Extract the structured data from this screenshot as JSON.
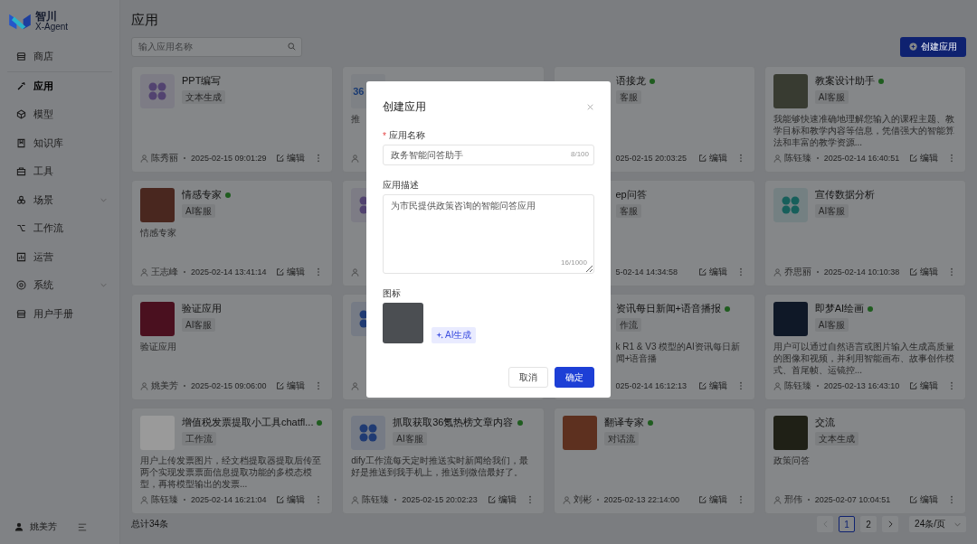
{
  "sidebar": {
    "brand": {
      "name": "智川",
      "subtitle": "X-Agent"
    },
    "items": [
      {
        "label": "商店",
        "selected": false,
        "submenu": false
      },
      {
        "label": "应用",
        "selected": true,
        "submenu": false
      },
      {
        "label": "模型",
        "selected": false,
        "submenu": false
      },
      {
        "label": "知识库",
        "selected": false,
        "submenu": false
      },
      {
        "label": "工具",
        "selected": false,
        "submenu": false
      },
      {
        "label": "场景",
        "selected": false,
        "submenu": true,
        "expanded": false
      },
      {
        "label": "工作流",
        "selected": false,
        "submenu": false
      },
      {
        "label": "运营",
        "selected": false,
        "submenu": false
      },
      {
        "label": "系统",
        "selected": false,
        "submenu": true,
        "expanded": false
      },
      {
        "label": "用户手册",
        "selected": false,
        "submenu": false
      }
    ],
    "user": {
      "name": "姚美芳"
    }
  },
  "page": {
    "title": "应用",
    "search": {
      "placeholder": "输入应用名称"
    },
    "create_button": "创建应用"
  },
  "cards": [
    {
      "kind": "full",
      "title": "PPT编写",
      "online": false,
      "tag": "文本生成",
      "author": "陈秀丽",
      "time": "2025-02-15 09:01:29",
      "edit": "编辑",
      "icon": {
        "kind": "app",
        "color": "#524370"
      }
    },
    {
      "kind": "edge",
      "description": "推",
      "icon": {
        "kind": "logo",
        "text": "36",
        "color": "#193a72"
      }
    },
    {
      "kind": "partial",
      "title": "语接龙",
      "online": true,
      "tag": "客服",
      "time": "025-02-15 20:03:25",
      "edit": "编辑"
    },
    {
      "kind": "full",
      "title": "教案设计助手",
      "online": true,
      "tag": "AI客服",
      "description": "我能够快速准确地理解您输入的课程主题、教学目标和教学内容等信息，凭借强大的智能算法和丰富的教学资源...",
      "author": "陈钰臻",
      "time": "2025-02-14 16:40:51",
      "edit": "编辑",
      "icon": {
        "kind": "photo",
        "color": "#383b31"
      }
    },
    {
      "kind": "full",
      "title": "情感专家",
      "online": true,
      "tag": "AI客服",
      "description": "情感专家",
      "author": "王志峰",
      "time": "2025-02-14 13:41:14",
      "edit": "编辑",
      "icon": {
        "kind": "photo",
        "color": "#49271f"
      }
    },
    {
      "kind": "edge",
      "icon": {
        "kind": "app",
        "color": "#524370"
      }
    },
    {
      "kind": "partial",
      "title": "ep问答",
      "online": false,
      "tag": "客服",
      "time": "5-02-14 14:34:58",
      "edit": "编辑"
    },
    {
      "kind": "full",
      "title": "宣传数据分析",
      "online": false,
      "tag": "AI客服",
      "author": "乔思丽",
      "time": "2025-02-14 10:10:38",
      "edit": "编辑",
      "icon": {
        "kind": "app",
        "color": "#175f5b"
      }
    },
    {
      "kind": "full",
      "title": "验证应用",
      "online": false,
      "tag": "AI客服",
      "description": "验证应用",
      "author": "姚美芳",
      "time": "2025-02-15 09:06:00",
      "edit": "编辑",
      "icon": {
        "kind": "photo",
        "color": "#4a101f"
      }
    },
    {
      "kind": "edge",
      "icon": {
        "kind": "app",
        "color": "#203b73"
      }
    },
    {
      "kind": "partial",
      "title": "资讯每日新闻+语音播报",
      "online": true,
      "tag": "作流",
      "description": "k R1 & V3 模型的AI资讯每日新闻+语音播",
      "time": "025-02-14 16:12:13",
      "edit": "编辑"
    },
    {
      "kind": "full",
      "title": "即梦AI绘画",
      "online": true,
      "tag": "AI客服",
      "description": "用户可以通过自然语言或图片输入生成高质量的图像和视频，并利用智能画布、故事创作模式、首尾帧、运镜控...",
      "author": "陈钰臻",
      "time": "2025-02-13 16:43:10",
      "edit": "编辑",
      "icon": {
        "kind": "photo",
        "color": "#0f1827"
      }
    },
    {
      "kind": "full",
      "title": "增值税发票提取小工具chatfl...",
      "online": true,
      "tag": "工作流",
      "description": "用户上传发票图片，经文档提取器提取后传至两个实现发票票面信息提取功能的多模态模型，再将模型输出的发票...",
      "author": "陈钰臻",
      "time": "2025-02-14 16:21:04",
      "edit": "编辑",
      "icon": {
        "kind": "photo",
        "color": "#9a9a9a"
      }
    },
    {
      "kind": "full",
      "title": "抓取获取36氪热榜文章内容",
      "online": true,
      "tag": "AI客服",
      "description": "dify工作流每天定时推送实时新闻给我们，最好是推送到我手机上，推送到微信最好了。",
      "author": "陈钰臻",
      "time": "2025-02-15 20:02:23",
      "edit": "编辑",
      "icon": {
        "kind": "app",
        "color": "#203b73"
      }
    },
    {
      "kind": "full",
      "title": "翻译专家",
      "online": true,
      "tag": "对话流",
      "author": "刘彬",
      "time": "2025-02-13 22:14:00",
      "edit": "编辑",
      "icon": {
        "kind": "photo",
        "color": "#5d301f"
      }
    },
    {
      "kind": "full",
      "title": "交流",
      "online": false,
      "tag": "文本生成",
      "description": "政策问答",
      "author": "邢伟",
      "time": "2025-02-07 10:04:51",
      "edit": "编辑",
      "icon": {
        "kind": "photo",
        "color": "#1f2016"
      }
    }
  ],
  "footer": {
    "total": "总计34条",
    "pagination": {
      "prev_disabled": true,
      "next_disabled": false,
      "pages": [
        {
          "label": "1",
          "selected": true
        },
        {
          "label": "2",
          "selected": false
        }
      ],
      "page_size": "24条/页"
    }
  },
  "dialog": {
    "title": "创建应用",
    "fields": [
      {
        "kind": "input",
        "label": "应用名称",
        "required_mark": "*",
        "value": "政务智能问答助手",
        "counter": "8/100"
      },
      {
        "kind": "textarea",
        "label": "应用描述",
        "value": "为市民提供政策咨询的智能问答应用",
        "counter": "16/1000"
      }
    ],
    "icon_label": "图标",
    "ai_button": "AI生成",
    "cancel": "取消",
    "confirm": "确定"
  }
}
